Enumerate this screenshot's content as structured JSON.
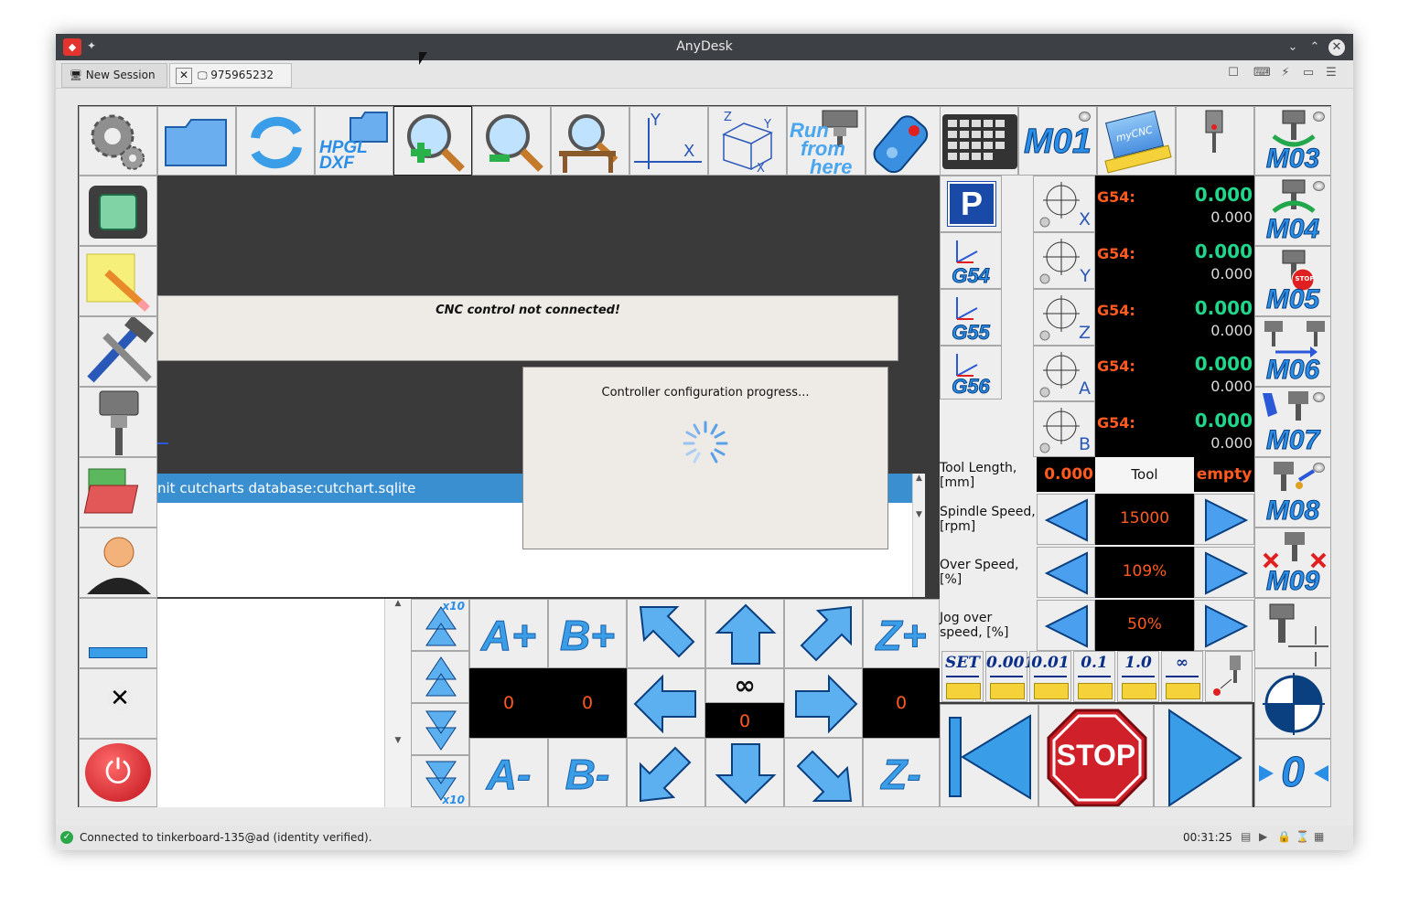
{
  "window": {
    "title": "AnyDesk",
    "tabs": [
      {
        "label": "New Session"
      },
      {
        "label": "975965232"
      }
    ]
  },
  "toolbar_top": {
    "hpgl_label": "HPGL",
    "dxf_label": "DXF",
    "axis_x": "X",
    "axis_y": "Y",
    "cube_labels": [
      "Z",
      "Y",
      "X"
    ],
    "run_from_here": [
      "Run",
      "from",
      "here"
    ]
  },
  "mcodes": {
    "m01": "M01",
    "m03": "M03",
    "m04": "M04",
    "m05": "M05",
    "m06": "M06",
    "m07": "M07",
    "m08": "M08",
    "m09": "M09",
    "mycnc": "myCNC",
    "stop_badge": "STOP"
  },
  "coord_systems": {
    "park": "P",
    "g54": "G54",
    "g55": "G55",
    "g56": "G56"
  },
  "axes": [
    {
      "axis": "X",
      "wcs": "G54:",
      "work": "0.000",
      "machine": "0.000"
    },
    {
      "axis": "Y",
      "wcs": "G54:",
      "work": "0.000",
      "machine": "0.000"
    },
    {
      "axis": "Z",
      "wcs": "G54:",
      "work": "0.000",
      "machine": "0.000"
    },
    {
      "axis": "A",
      "wcs": "G54:",
      "work": "0.000",
      "machine": "0.000"
    },
    {
      "axis": "B",
      "wcs": "G54:",
      "work": "0.000",
      "machine": "0.000"
    }
  ],
  "tool_panel": {
    "tool_length_label": "Tool Length,\n[mm]",
    "tool_length_value": "0.000",
    "tool_label": "Tool",
    "tool_value": "empty",
    "spindle_label": "Spindle Speed,\n[rpm]",
    "spindle_value": "15000",
    "over_speed_label": "Over Speed,\n[%]",
    "over_speed_value": "109%",
    "jog_label": "Jog over\nspeed, [%]",
    "jog_value": "50%"
  },
  "jog_rates": [
    "SET",
    "0.001",
    "0.01",
    "0.1",
    "1.0",
    "∞"
  ],
  "messages": {
    "cnc_status": "CNC control not connected!",
    "log_line": "nit cutcharts database:cutchart.sqlite",
    "dialog": "Controller configuration progress..."
  },
  "jog": {
    "a_plus": "A+",
    "b_plus": "B+",
    "z_plus": "Z+",
    "a_minus": "A-",
    "b_minus": "B-",
    "z_minus": "Z-",
    "a_value": "0",
    "b_value": "0",
    "z_value": "0",
    "step_value": "0",
    "infinity": "∞",
    "x10_top": "x10",
    "x10_bottom": "x10"
  },
  "controls": {
    "stop_label": "STOP",
    "zero_label": "0"
  },
  "statusbar": {
    "text": "Connected to tinkerboard-135@ad (identity verified).",
    "time": "00:31:25"
  },
  "colors": {
    "accent_blue": "#2a8ee6",
    "display_orange": "#ff5a1f",
    "display_green": "#21d68a",
    "stop_red": "#d0202a"
  }
}
